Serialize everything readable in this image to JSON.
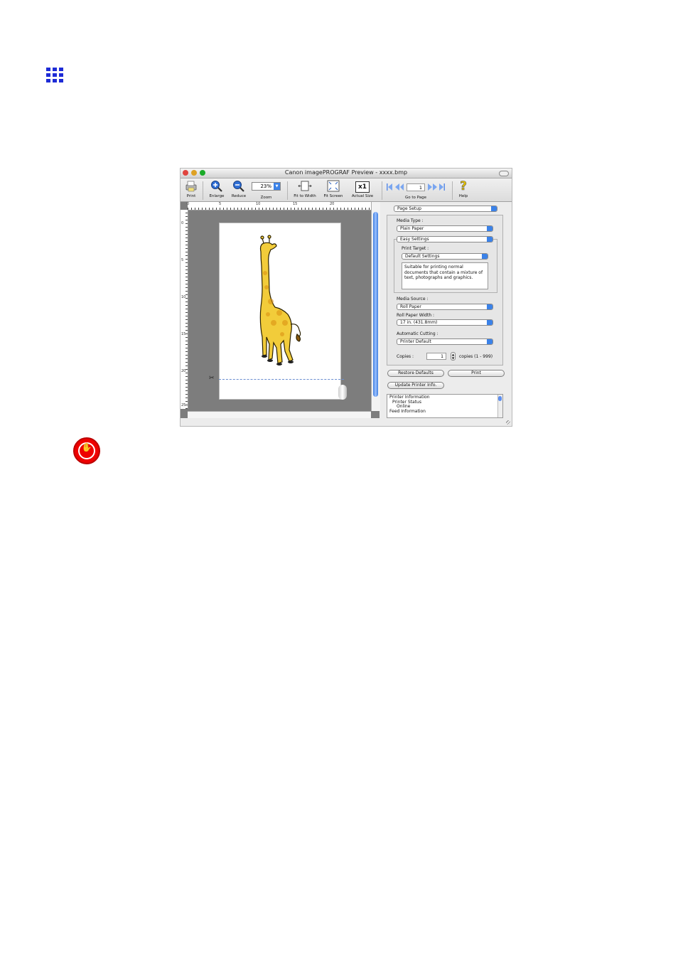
{
  "window": {
    "title": "Canon imagePROGRAF Preview - xxxx.bmp"
  },
  "toolbar": {
    "print_label": "Print",
    "enlarge_label": "Enlarge",
    "reduce_label": "Reduce",
    "zoom_value": "23%",
    "zoom_label": "Zoom",
    "fit_width_label": "Fit to Width",
    "fit_screen_label": "Fit Screen",
    "actual_size_label": "Actual Size",
    "actual_size_glyph": "x1",
    "page_value": "1",
    "goto_page_label": "Go to Page",
    "help_label": "Help"
  },
  "rulers": {
    "h": [
      "0",
      "5",
      "10",
      "15",
      "20"
    ],
    "v": [
      "0",
      "5",
      "10",
      "15",
      "20",
      "25"
    ]
  },
  "panel": {
    "mode_select": "Page Setup",
    "media_type_label": "Media Type :",
    "media_type_value": "Plain Paper",
    "easy_settings_value": "Easy Settings",
    "print_target_label": "Print Target :",
    "print_target_value": "Default Settings",
    "description": "Suitable for printing normal documents that contain a mixture of text, photographs and graphics.",
    "media_source_label": "Media Source :",
    "media_source_value": "Roll Paper",
    "roll_width_label": "Roll Paper Width :",
    "roll_width_value": "17 in. (431.8mm)",
    "auto_cut_label": "Automatic Cutting :",
    "auto_cut_value": "Printer Default",
    "copies_label": "Copies :",
    "copies_value": "1",
    "copies_range": "copies (1 - 999)",
    "restore_label": "Restore Defaults",
    "print_label": "Print",
    "update_label": "Update Printer Info.",
    "info_lines": [
      "Printer Information",
      "Printer Status",
      "Online",
      "Feed Information"
    ]
  },
  "colors": {
    "accent": "#3b82e8",
    "doc_icon": "#1d2bd6",
    "stop_icon": "#e00000"
  }
}
